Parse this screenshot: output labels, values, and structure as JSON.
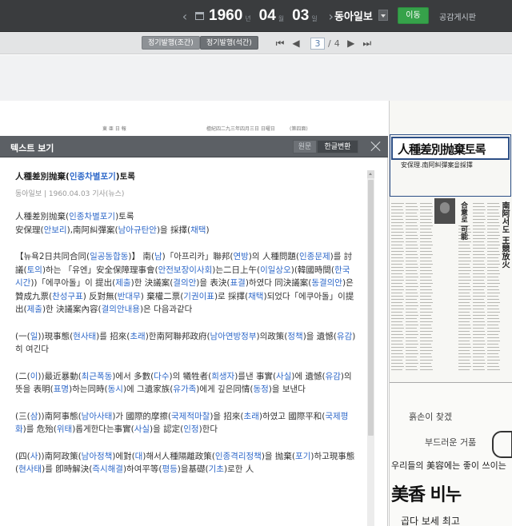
{
  "date": {
    "year": "1960",
    "year_unit": "년",
    "month": "04",
    "month_unit": "월",
    "day": "03",
    "day_unit": "일"
  },
  "newspaper": "동아일보",
  "move_button": "이동",
  "board_link": "공감게시판",
  "toolbar": {
    "tab_active": "정기발행(조간)",
    "tab_inactive": "정기발행(석간)",
    "page_current": "3",
    "page_separator": "/",
    "page_total": "4"
  },
  "strip": {
    "left": "東 亜 日 報",
    "middle": "檀紀四二九三年四月三日 日曜日",
    "right": "(第四面)"
  },
  "panel": {
    "title": "텍스트 보기",
    "seg_original": "원문",
    "seg_converted": "한글변환"
  },
  "article": {
    "title_a": "人種差別抛棄(",
    "title_hangul": "인종차별포기",
    "title_b": ")토록",
    "meta": "동아일보 | 1960.04.03 기사(뉴스)",
    "headline1_a": "人種差別抛棄(",
    "headline1_h": "인종차별포기",
    "headline1_b": ")토록",
    "headline2_a": "安保理(",
    "headline2_h1": "안보리",
    "headline2_b": "),南阿糾彈案(",
    "headline2_h2": "남아규탄안",
    "headline2_c": ")을 採擇(",
    "headline2_h3": "채택",
    "headline2_d": ")",
    "p1": [
      {
        "t": "【뉴욕2日共同合同(",
        "h": false
      },
      {
        "t": "일공동합동",
        "h": true
      },
      {
        "t": ")】 南(",
        "h": false
      },
      {
        "t": "남",
        "h": true
      },
      {
        "t": ")「아프리카」聯邦(",
        "h": false
      },
      {
        "t": "연방",
        "h": true
      },
      {
        "t": ")의 人種問題(",
        "h": false
      },
      {
        "t": "인종문제",
        "h": true
      },
      {
        "t": ")를 討議(",
        "h": false
      },
      {
        "t": "토의",
        "h": true
      },
      {
        "t": ")하는 「유엔」安全保障理事會(",
        "h": false
      },
      {
        "t": "안전보장이사회",
        "h": true
      },
      {
        "t": ")는二日上午(",
        "h": false
      },
      {
        "t": "이일상오",
        "h": true
      },
      {
        "t": ")(韓國時間(",
        "h": false
      },
      {
        "t": "한국시간",
        "h": true
      },
      {
        "t": "))「에쿠아돌」이 提出(",
        "h": false
      },
      {
        "t": "제출",
        "h": true
      },
      {
        "t": ")한 決議案(",
        "h": false
      },
      {
        "t": "결의안",
        "h": true
      },
      {
        "t": ")을 表決(",
        "h": false
      },
      {
        "t": "표결",
        "h": true
      },
      {
        "t": ")하였다 同決議案(",
        "h": false
      },
      {
        "t": "동결의안",
        "h": true
      },
      {
        "t": ")은 贊成九票(",
        "h": false
      },
      {
        "t": "찬성구표",
        "h": true
      },
      {
        "t": ") 反對無(",
        "h": false
      },
      {
        "t": "반대무",
        "h": true
      },
      {
        "t": ") 棄權二票(",
        "h": false
      },
      {
        "t": "기권이표",
        "h": true
      },
      {
        "t": ")로 採擇(",
        "h": false
      },
      {
        "t": "채택",
        "h": true
      },
      {
        "t": ")되었다「에쿠아돌」이提出(",
        "h": false
      },
      {
        "t": "제출",
        "h": true
      },
      {
        "t": ")한 決議案內容(",
        "h": false
      },
      {
        "t": "결의안내용",
        "h": true
      },
      {
        "t": ")은 다음과같다",
        "h": false
      }
    ],
    "p2": [
      {
        "t": "(一(",
        "h": false
      },
      {
        "t": "일",
        "h": true
      },
      {
        "t": "))現事態(",
        "h": false
      },
      {
        "t": "현사태",
        "h": true
      },
      {
        "t": ")를 招來(",
        "h": false
      },
      {
        "t": "초래",
        "h": true
      },
      {
        "t": ")한南阿聯邦政府(",
        "h": false
      },
      {
        "t": "남아연방정부",
        "h": true
      },
      {
        "t": ")의政策(",
        "h": false
      },
      {
        "t": "정책",
        "h": true
      },
      {
        "t": ")을 遺憾(",
        "h": false
      },
      {
        "t": "유감",
        "h": true
      },
      {
        "t": ")히 여긴다",
        "h": false
      }
    ],
    "p3": [
      {
        "t": "(二(",
        "h": false
      },
      {
        "t": "이",
        "h": true
      },
      {
        "t": "))最近暴動(",
        "h": false
      },
      {
        "t": "최근폭동",
        "h": true
      },
      {
        "t": ")에서 多數(",
        "h": false
      },
      {
        "t": "다수",
        "h": true
      },
      {
        "t": ")의 犧牲者(",
        "h": false
      },
      {
        "t": "희생자",
        "h": true
      },
      {
        "t": ")를낸 事實(",
        "h": false
      },
      {
        "t": "사실",
        "h": true
      },
      {
        "t": ")에 遺憾(",
        "h": false
      },
      {
        "t": "유감",
        "h": true
      },
      {
        "t": ")의뜻을 表明(",
        "h": false
      },
      {
        "t": "표명",
        "h": true
      },
      {
        "t": ")하는同時(",
        "h": false
      },
      {
        "t": "동시",
        "h": true
      },
      {
        "t": ")에 그遺家族(",
        "h": false
      },
      {
        "t": "유가족",
        "h": true
      },
      {
        "t": ")에게 깊은同情(",
        "h": false
      },
      {
        "t": "동정",
        "h": true
      },
      {
        "t": ")을 보낸다",
        "h": false
      }
    ],
    "p4": [
      {
        "t": "(三(",
        "h": false
      },
      {
        "t": "삼",
        "h": true
      },
      {
        "t": "))南阿事態(",
        "h": false
      },
      {
        "t": "남아사태",
        "h": true
      },
      {
        "t": ")가 國際的摩擦(",
        "h": false
      },
      {
        "t": "국제적마찰",
        "h": true
      },
      {
        "t": ")을 招來(",
        "h": false
      },
      {
        "t": "초래",
        "h": true
      },
      {
        "t": ")하였고 國際平和(",
        "h": false
      },
      {
        "t": "국제평화",
        "h": true
      },
      {
        "t": ")를 危殆(",
        "h": false
      },
      {
        "t": "위태",
        "h": true
      },
      {
        "t": ")롭게한다는事實(",
        "h": false
      },
      {
        "t": "사실",
        "h": true
      },
      {
        "t": ")을 認定(",
        "h": false
      },
      {
        "t": "인정",
        "h": true
      },
      {
        "t": ")한다",
        "h": false
      }
    ],
    "p5": [
      {
        "t": "(四(",
        "h": false
      },
      {
        "t": "사",
        "h": true
      },
      {
        "t": "))南阿政策(",
        "h": false
      },
      {
        "t": "남아정책",
        "h": true
      },
      {
        "t": ")에對(",
        "h": false
      },
      {
        "t": "대",
        "h": true
      },
      {
        "t": ")해서人種隔離政策(",
        "h": false
      },
      {
        "t": "인종격리정책",
        "h": true
      },
      {
        "t": ")을 抛棄(",
        "h": false
      },
      {
        "t": "포기",
        "h": true
      },
      {
        "t": ")하고現事態(",
        "h": false
      },
      {
        "t": "현사태",
        "h": true
      },
      {
        "t": ")를 卽時解決(",
        "h": false
      },
      {
        "t": "즉시해결",
        "h": true
      },
      {
        "t": ")하여平等(",
        "h": false
      },
      {
        "t": "평등",
        "h": true
      },
      {
        "t": ")을基礎(",
        "h": false
      },
      {
        "t": "기초",
        "h": true
      },
      {
        "t": ")로한 人",
        "h": false
      }
    ]
  },
  "scan": {
    "headline": "人種差別抛棄토록",
    "subhead": "安保理.南阿糾彈案을採擇",
    "vhead1": "南阿서도 王競放火",
    "vhead2": "合意로 可能",
    "ad_script1": "흙손이 찾겠",
    "ad_script2": "부드러운 거품",
    "ad_slogan": "우리들의 美容에는 좋이 쓰이는",
    "ad_brand": "美香 비누",
    "ad_bottom": "곱다 보세 최고"
  }
}
